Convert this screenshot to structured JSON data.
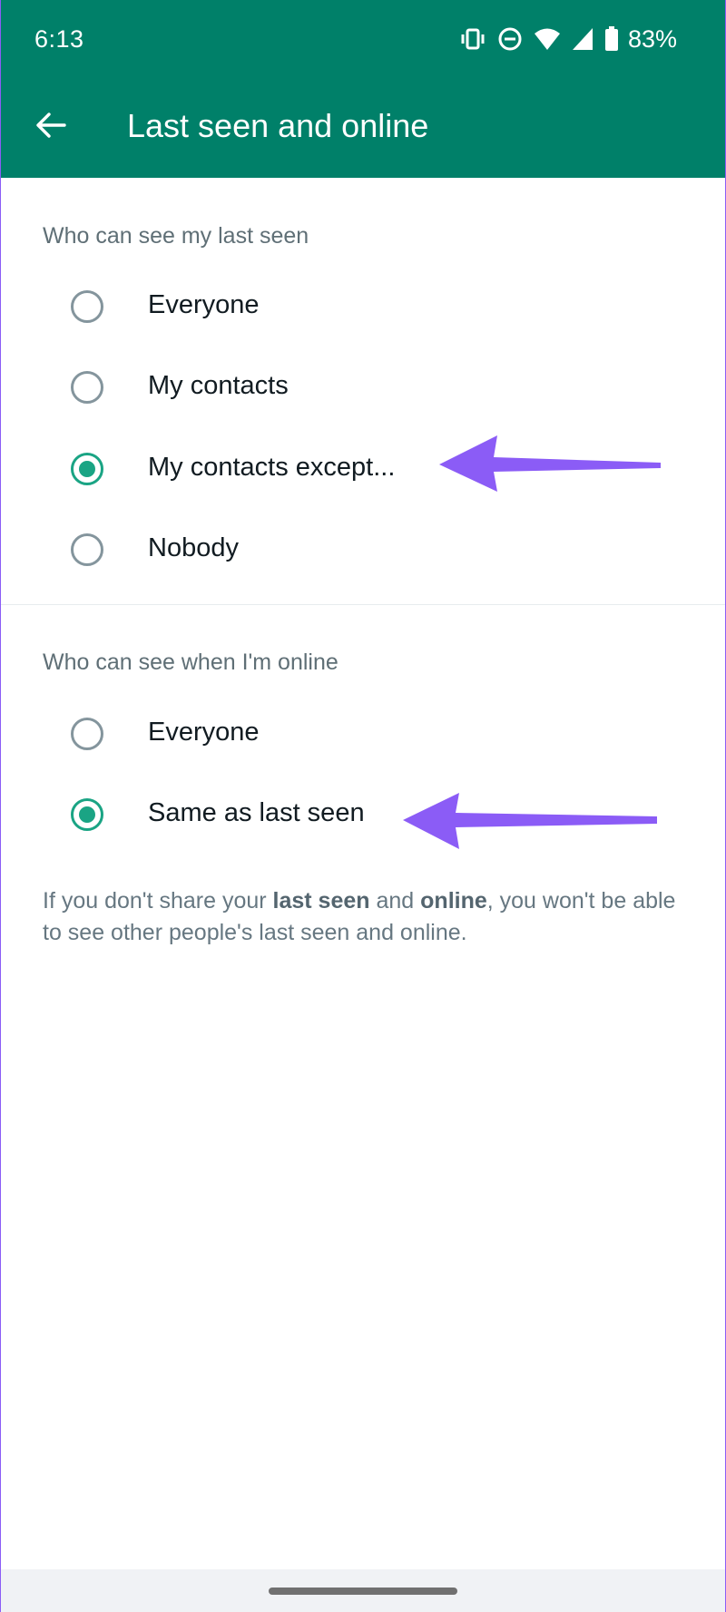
{
  "status_bar": {
    "time": "6:13",
    "icons": [
      "vibrate-icon",
      "do-not-disturb-icon",
      "wifi-icon",
      "cell-signal-icon",
      "battery-icon"
    ],
    "battery": "83%"
  },
  "app_bar": {
    "back_icon": "arrow-left-icon",
    "title": "Last seen and online"
  },
  "last_seen_section": {
    "title": "Who can see my last seen",
    "options": [
      {
        "label": "Everyone",
        "selected": false
      },
      {
        "label": "My contacts",
        "selected": false
      },
      {
        "label": "My contacts except...",
        "selected": true
      },
      {
        "label": "Nobody",
        "selected": false
      }
    ]
  },
  "online_section": {
    "title": "Who can see when I'm online",
    "options": [
      {
        "label": "Everyone",
        "selected": false
      },
      {
        "label": "Same as last seen",
        "selected": true
      }
    ]
  },
  "footnote": {
    "part1": "If you don't share your ",
    "bold1": "last seen",
    "part2": " and ",
    "bold2": "online",
    "part3": ", you won't be able to see other people's last seen and online."
  },
  "colors": {
    "header": "#008069",
    "radio_selected": "#1aa484",
    "annotation_arrow": "#8b5cf6"
  }
}
